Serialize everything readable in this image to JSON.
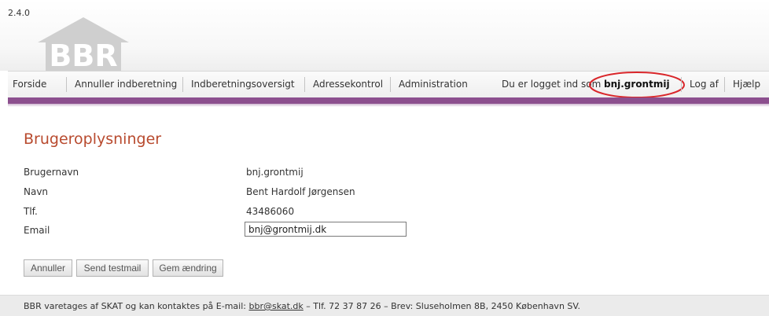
{
  "header": {
    "version": "2.4.0",
    "logo_text": "BBR"
  },
  "nav": {
    "items": [
      {
        "label": "Forside"
      },
      {
        "label": "Annuller indberetning"
      },
      {
        "label": "Indberetningsoversigt"
      },
      {
        "label": "Adressekontrol"
      },
      {
        "label": "Administration"
      }
    ],
    "login_text": "Du er logget ind som",
    "username": "bnj.grontmij",
    "logout_label": "Log af",
    "help_label": "Hjælp"
  },
  "colors": {
    "accent_band": "#8c4f8e",
    "title": "#b84a2e",
    "highlight_ellipse": "#d9262a"
  },
  "main": {
    "title": "Brugeroplysninger",
    "fields": [
      {
        "label": "Brugernavn",
        "value": "bnj.grontmij"
      },
      {
        "label": "Navn",
        "value": "Bent Hardolf Jørgensen"
      },
      {
        "label": "Tlf.",
        "value": "43486060"
      },
      {
        "label": "Email",
        "value": "bnj@grontmij.dk"
      }
    ],
    "buttons": {
      "cancel": "Annuller",
      "send_testmail": "Send testmail",
      "save": "Gem ændring"
    }
  },
  "footer": {
    "text_before": "BBR varetages af SKAT og kan kontaktes på E-mail: ",
    "email_link": "bbr@skat.dk",
    "text_after": " – Tlf. 72 37 87 26 – Brev: Sluseholmen 8B, 2450 København SV."
  }
}
